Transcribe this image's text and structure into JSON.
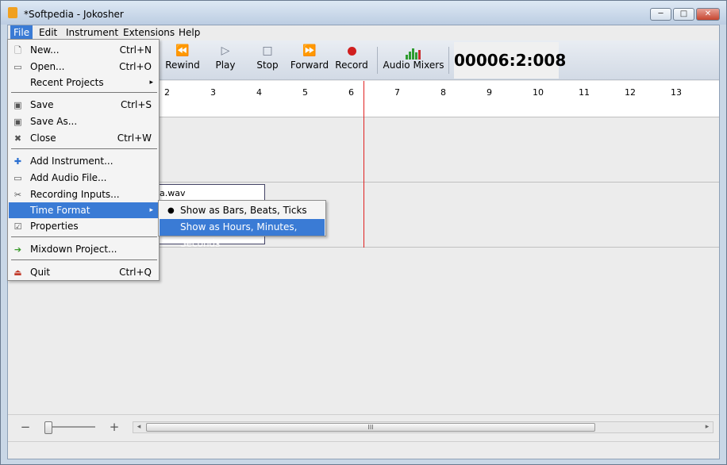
{
  "window": {
    "title": "*Softpedia - Jokosher",
    "min": "─",
    "max": "□",
    "close": "✕"
  },
  "menubar": [
    "File",
    "Edit",
    "Instrument",
    "Extensions",
    "Help"
  ],
  "toolbar": {
    "rewind": "Rewind",
    "play": "Play",
    "stop": "Stop",
    "forward": "Forward",
    "record": "Record",
    "mixers": "Audio Mixers",
    "timer": "00006:2:008"
  },
  "ruler": [
    "2",
    "3",
    "4",
    "5",
    "6",
    "7",
    "8",
    "9",
    "10",
    "11",
    "12",
    "13"
  ],
  "event": {
    "label": "a.wav"
  },
  "bottom": {
    "zoom_out": "−",
    "zoom_in": "+",
    "scroll_left": "◂",
    "scroll_right": "▸",
    "grip": "III"
  },
  "file_menu": {
    "items": [
      {
        "label": "New...",
        "accel": "Ctrl+N",
        "icon": "new-file-icon",
        "glyph": "🗋"
      },
      {
        "label": "Open...",
        "accel": "Ctrl+O",
        "icon": "open-folder-icon",
        "glyph": "▭"
      },
      {
        "label": "Recent Projects",
        "accel": "",
        "icon": "",
        "glyph": ""
      },
      {
        "label": "Save",
        "accel": "Ctrl+S",
        "icon": "save-icon",
        "glyph": "▣"
      },
      {
        "label": "Save As...",
        "accel": "",
        "icon": "save-as-icon",
        "glyph": "▣"
      },
      {
        "label": "Close",
        "accel": "Ctrl+W",
        "icon": "close-x-icon",
        "glyph": "✖"
      },
      {
        "label": "Add Instrument...",
        "accel": "",
        "icon": "add-plus-icon",
        "glyph": "✚"
      },
      {
        "label": "Add Audio File...",
        "accel": "",
        "icon": "folder-icon",
        "glyph": "▭"
      },
      {
        "label": "Recording Inputs...",
        "accel": "",
        "icon": "tools-icon",
        "glyph": "✂"
      },
      {
        "label": "Time Format",
        "accel": "",
        "icon": "",
        "glyph": ""
      },
      {
        "label": "Properties",
        "accel": "",
        "icon": "properties-icon",
        "glyph": "☑"
      },
      {
        "label": "Mixdown Project...",
        "accel": "",
        "icon": "mixdown-arrow-icon",
        "glyph": "➔"
      },
      {
        "label": "Quit",
        "accel": "Ctrl+Q",
        "icon": "quit-door-icon",
        "glyph": "⏏"
      }
    ],
    "arrow": "▸"
  },
  "time_submenu": {
    "bullet": "●",
    "items": [
      "Show as Bars, Beats, Ticks",
      "Show as Hours, Minutes, Seconds"
    ]
  }
}
